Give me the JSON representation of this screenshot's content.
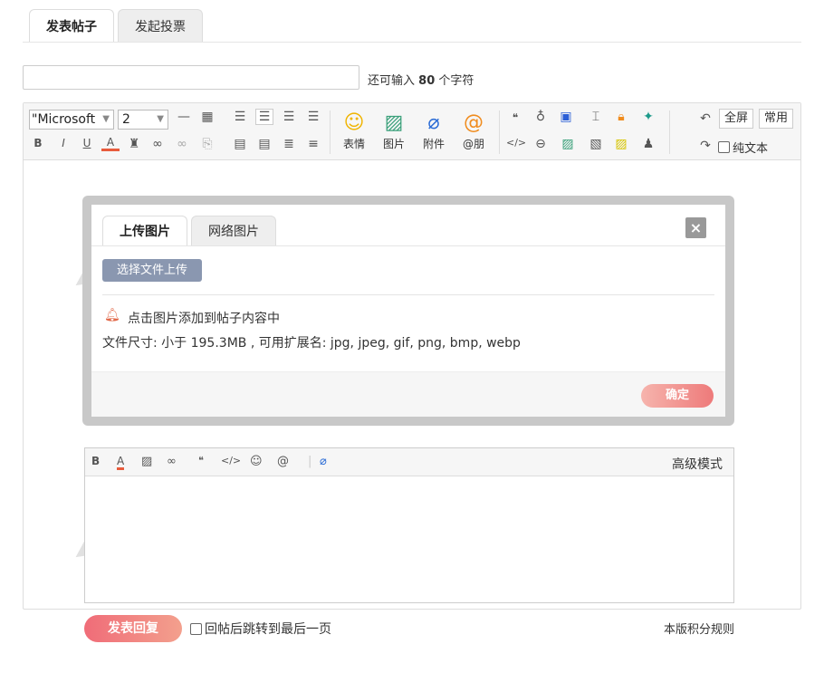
{
  "tabs": [
    {
      "label": "发表帖子"
    },
    {
      "label": "发起投票"
    }
  ],
  "title": {
    "hint_prefix": "还可输入",
    "hint_count": "80",
    "hint_suffix": "个字符"
  },
  "toolbar": {
    "font": "\"Microsoft",
    "size": "2",
    "buttons": [
      {
        "label": "表情",
        "icon": "smile-icon"
      },
      {
        "label": "图片",
        "icon": "image-icon"
      },
      {
        "label": "附件",
        "icon": "paperclip-icon"
      },
      {
        "label": "@朋",
        "icon": "at-icon"
      }
    ],
    "fullscreen": "全屏",
    "common": "常用",
    "plaintext": "纯文本"
  },
  "modal": {
    "tabs": [
      {
        "label": "上传图片"
      },
      {
        "label": "网络图片"
      }
    ],
    "close": "×",
    "upload": "选择文件上传",
    "tip": "点击图片添加到帖子内容中",
    "filesize": "文件尺寸: 小于 195.3MB , 可用扩展名: jpg, jpeg, gif, png, bmp, webp",
    "confirm": "确定"
  },
  "quickreply": {
    "advanced": "高级模式"
  },
  "footer": {
    "reply": "发表回复",
    "jump": "回帖后跳转到最后一页",
    "rules": "本版积分规则"
  },
  "colors": {
    "accent": "#ee7a7a",
    "upload": "#8a97b0",
    "bell": "#e2694a"
  }
}
